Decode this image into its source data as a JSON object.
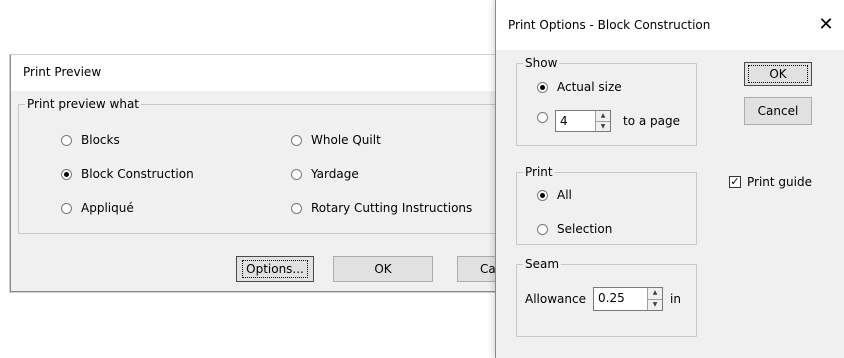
{
  "print_preview": {
    "title": "Print Preview",
    "group_label": "Print preview what",
    "options": [
      {
        "label": "Blocks",
        "selected": false
      },
      {
        "label": "Block Construction",
        "selected": true
      },
      {
        "label": "Appliqué",
        "selected": false
      },
      {
        "label": "Whole Quilt",
        "selected": false
      },
      {
        "label": "Yardage",
        "selected": false
      },
      {
        "label": "Rotary Cutting Instructions",
        "selected": false
      }
    ],
    "buttons": {
      "options": "Options...",
      "ok": "OK",
      "cancel": "Canc"
    }
  },
  "print_options": {
    "title": "Print Options - Block Construction",
    "close_glyph": "✕",
    "show": {
      "label": "Show",
      "actual_size": "Actual size",
      "pages_value": "4",
      "pages_suffix": "to a page",
      "selected": "Actual size"
    },
    "print": {
      "label": "Print",
      "all": "All",
      "selection": "Selection",
      "selected": "All"
    },
    "seam": {
      "label": "Seam",
      "allowance_label": "Allowance",
      "allowance_value": "0.25",
      "unit": "in"
    },
    "print_guide": {
      "label": "Print guide",
      "checked": true
    },
    "buttons": {
      "ok": "OK",
      "cancel": "Cancel"
    }
  }
}
